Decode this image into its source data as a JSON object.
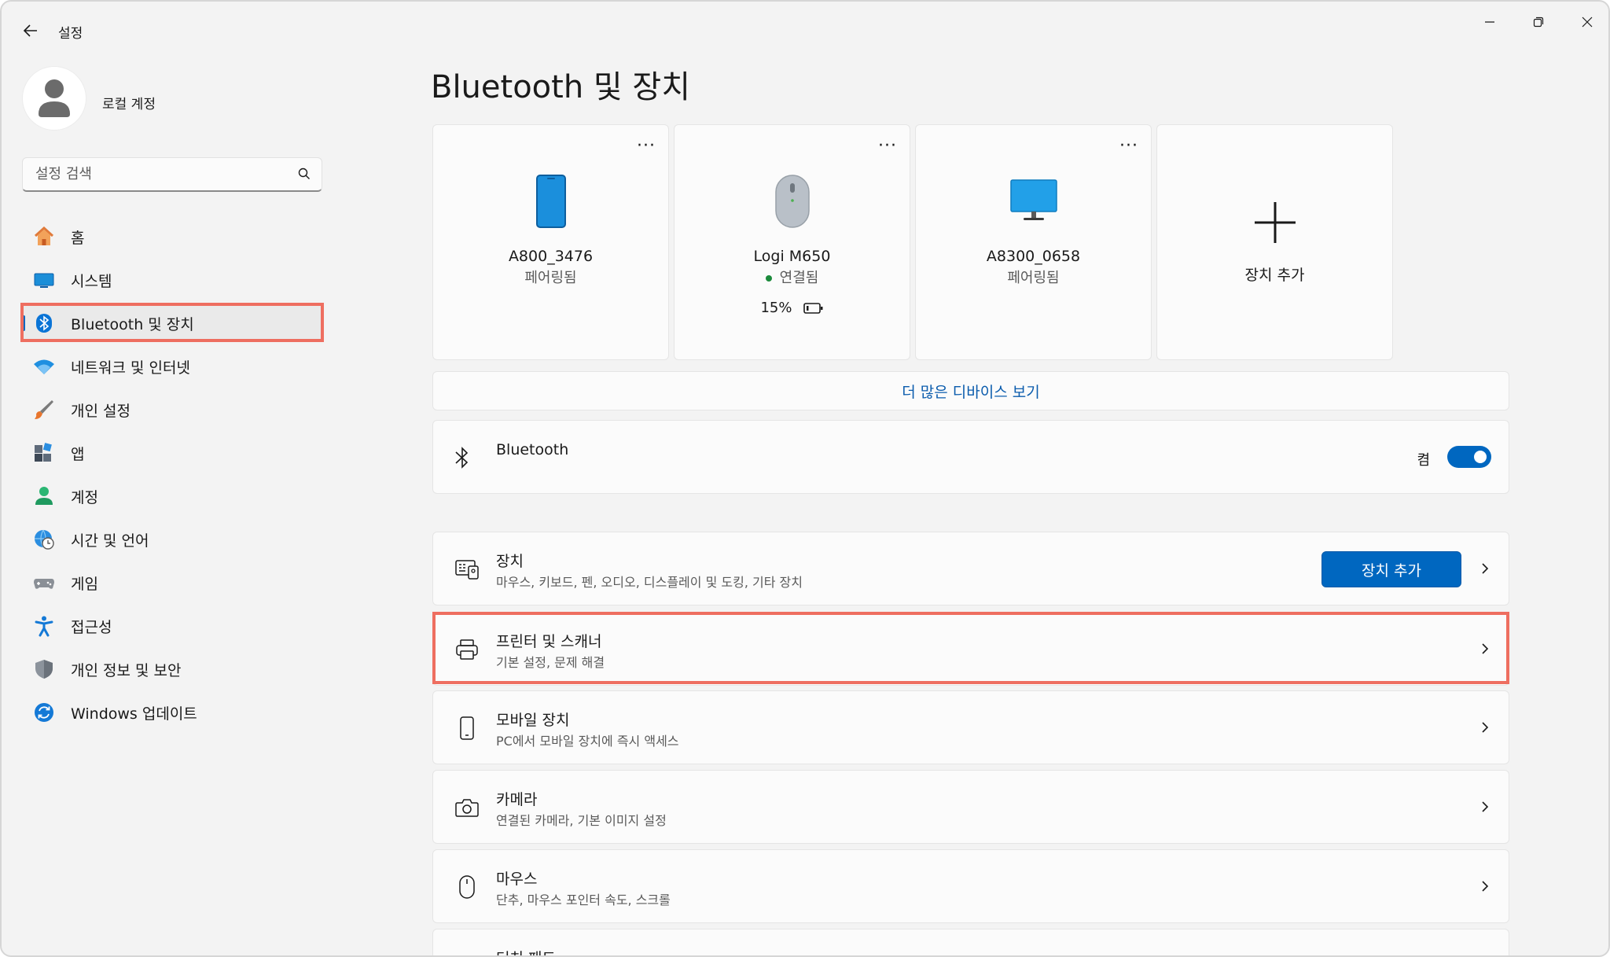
{
  "window": {
    "title": "설정"
  },
  "user": {
    "name": "로컬 계정"
  },
  "search": {
    "placeholder": "설정 검색"
  },
  "sidebar": {
    "items": [
      {
        "label": "홈",
        "icon": "home-icon"
      },
      {
        "label": "시스템",
        "icon": "system-icon"
      },
      {
        "label": "Bluetooth 및 장치",
        "icon": "bluetooth-icon",
        "active": true
      },
      {
        "label": "네트워크 및 인터넷",
        "icon": "wifi-icon"
      },
      {
        "label": "개인 설정",
        "icon": "brush-icon"
      },
      {
        "label": "앱",
        "icon": "apps-icon"
      },
      {
        "label": "계정",
        "icon": "account-icon"
      },
      {
        "label": "시간 및 언어",
        "icon": "globe-clock-icon"
      },
      {
        "label": "게임",
        "icon": "gamepad-icon"
      },
      {
        "label": "접근성",
        "icon": "accessibility-icon"
      },
      {
        "label": "개인 정보 및 보안",
        "icon": "shield-icon"
      },
      {
        "label": "Windows 업데이트",
        "icon": "update-icon"
      }
    ]
  },
  "main": {
    "title": "Bluetooth 및 장치",
    "devices": [
      {
        "name": "A800_3476",
        "status": "페어링됨",
        "icon": "phone-icon"
      },
      {
        "name": "Logi M650",
        "status": "연결됨",
        "battery": "15%",
        "icon": "mouse-device-icon"
      },
      {
        "name": "A8300_0658",
        "status": "페어링됨",
        "icon": "monitor-icon"
      }
    ],
    "add_device_card": "장치 추가",
    "more_devices": "더 많은 디바이스 보기",
    "bluetooth": {
      "label": "Bluetooth",
      "state": "켬"
    },
    "rows": [
      {
        "title": "장치",
        "subtitle": "마우스, 키보드, 펜, 오디오, 디스플레이 및 도킹, 기타 장치",
        "button": "장치 추가",
        "icon": "devices-icon"
      },
      {
        "title": "프린터 및 스캐너",
        "subtitle": "기본 설정, 문제 해결",
        "icon": "printer-icon"
      },
      {
        "title": "모바일 장치",
        "subtitle": "PC에서 모바일 장치에 즉시 액세스",
        "icon": "mobile-icon"
      },
      {
        "title": "카메라",
        "subtitle": "연결된 카메라, 기본 이미지 설정",
        "icon": "camera-icon"
      },
      {
        "title": "마우스",
        "subtitle": "단추, 마우스 포인터 속도, 스크롤",
        "icon": "mouse-icon"
      },
      {
        "title": "터치 패드",
        "subtitle": "",
        "icon": "touchpad-icon"
      }
    ]
  },
  "colors": {
    "accent": "#0067c0",
    "highlight": "#ee6e60",
    "link": "#0b5cad"
  }
}
